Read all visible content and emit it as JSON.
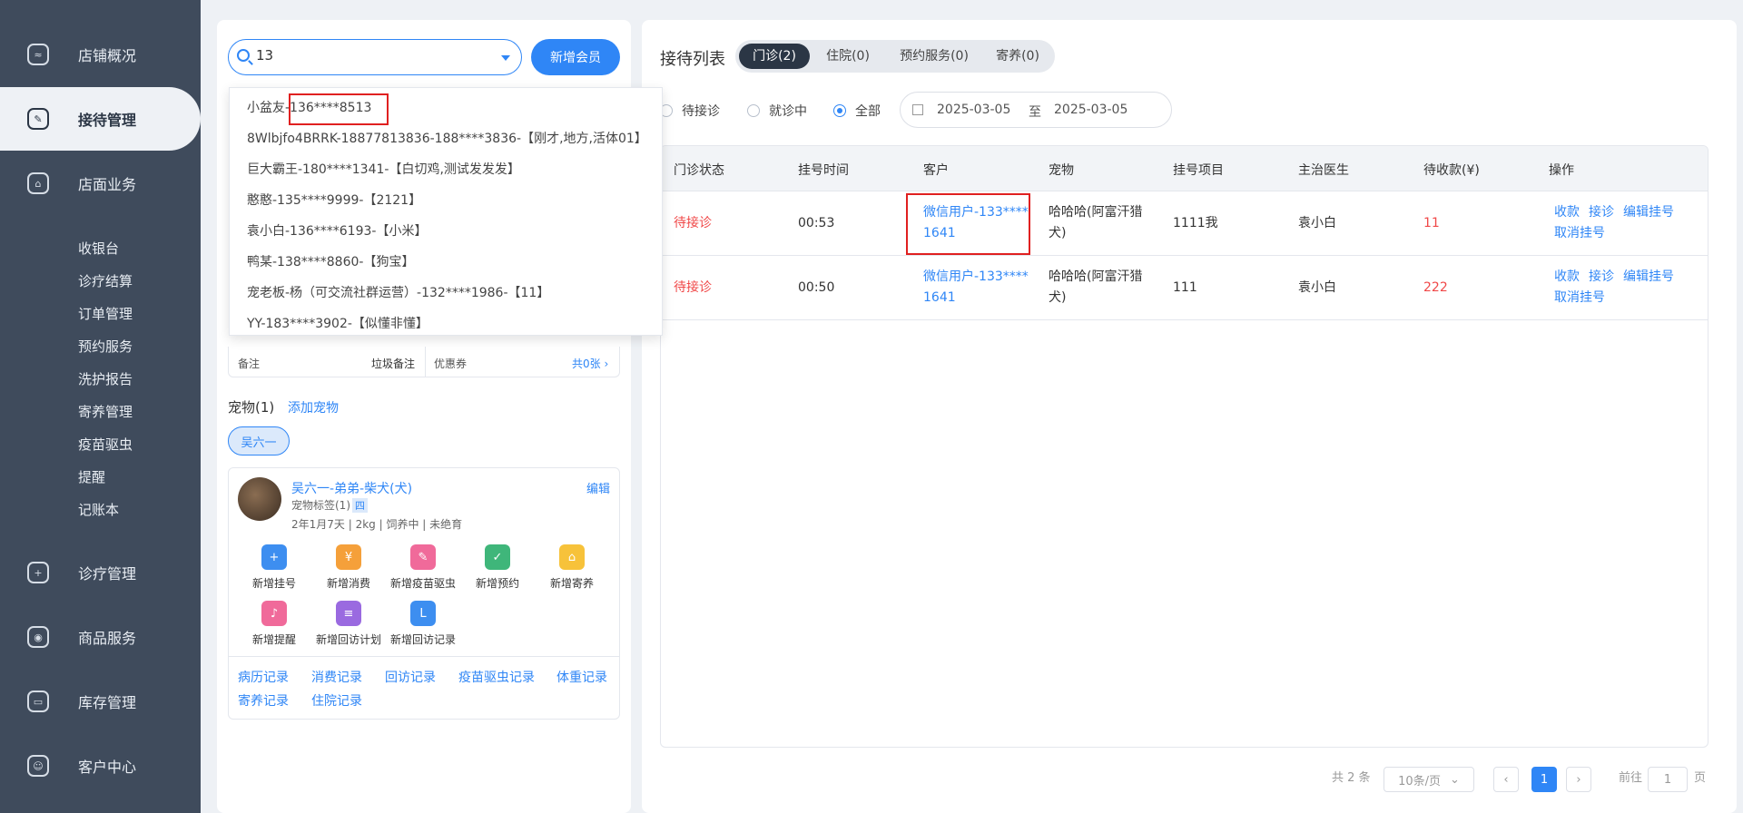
{
  "sidebar": {
    "items": [
      {
        "label": "店铺概况",
        "icon": "dashboard-icon"
      },
      {
        "label": "接待管理",
        "icon": "reception-icon",
        "active": true
      },
      {
        "label": "店面业务",
        "icon": "store-icon"
      },
      {
        "label": "诊疗管理",
        "icon": "medical-icon"
      },
      {
        "label": "商品服务",
        "icon": "goods-icon"
      },
      {
        "label": "库存管理",
        "icon": "inventory-icon"
      },
      {
        "label": "客户中心",
        "icon": "customer-icon"
      }
    ],
    "sub_items": [
      "收银台",
      "诊疗结算",
      "订单管理",
      "预约服务",
      "洗护报告",
      "寄养管理",
      "疫苗驱虫",
      "提醒",
      "记账本"
    ]
  },
  "search": {
    "value": "13",
    "add_member": "新增会员"
  },
  "dropdown": {
    "items": [
      "小盆友-136****8513",
      "8Wlbjfo4BRRK-18877813836-188****3836-【刚才,地方,活体01】",
      "巨大霸王-180****1341-【白切鸡,测试发发发】",
      "憨憨-135****9999-【2121】",
      "袁小白-136****6193-【小米】",
      "鸭某-138****8860-【狗宝】",
      "宠老板-杨（可交流社群运营）-132****1986-【11】",
      "YY-183****3902-【似懂非懂】"
    ]
  },
  "info": {
    "note_label": "备注",
    "note_value": "垃圾备注",
    "coupon_label": "优惠券",
    "coupon_value": "共0张 ›"
  },
  "pets": {
    "title": "宠物(1)",
    "add": "添加宠物",
    "tag": "吴六一",
    "card": {
      "name": "吴六一-弟弟-柴犬(犬)",
      "edit": "编辑",
      "label": "宠物标签(1)",
      "label_chip": "四",
      "meta": "2年1月7天 | 2kg | 饲养中 |  未绝育",
      "actions": [
        {
          "label": "新增挂号",
          "icon": "medkit-icon",
          "color": "#3d8ef0",
          "glyph": "+"
        },
        {
          "label": "新增消费",
          "icon": "yuan-icon",
          "color": "#f5a03a",
          "glyph": "¥"
        },
        {
          "label": "新增疫苗驱虫",
          "icon": "syringe-icon",
          "color": "#f06a9a",
          "glyph": "✎"
        },
        {
          "label": "新增预约",
          "icon": "calendar-icon",
          "color": "#3fb67a",
          "glyph": "✓"
        },
        {
          "label": "新增寄养",
          "icon": "house-icon",
          "color": "#f7c23a",
          "glyph": "⌂"
        },
        {
          "label": "新增提醒",
          "icon": "bell-icon",
          "color": "#f06a9a",
          "glyph": "♪"
        },
        {
          "label": "新增回访计划",
          "icon": "chat-icon",
          "color": "#9a6ae0",
          "glyph": "≡"
        },
        {
          "label": "新增回访记录",
          "icon": "clipboard-icon",
          "color": "#3d8ef0",
          "glyph": "L"
        }
      ],
      "records": [
        "病历记录",
        "消费记录",
        "回访记录",
        "疫苗驱虫记录",
        "体重记录",
        "寄养记录",
        "住院记录"
      ]
    }
  },
  "reception": {
    "title": "接待列表",
    "tabs": [
      "门诊(2)",
      "住院(0)",
      "预约服务(0)",
      "寄养(0)"
    ],
    "filters": [
      "待接诊",
      "就诊中",
      "全部"
    ],
    "date_from": "2025-03-05",
    "date_sep": "至",
    "date_to": "2025-03-05",
    "columns": [
      "门诊状态",
      "挂号时间",
      "客户",
      "宠物",
      "挂号项目",
      "主治医生",
      "待收款(¥)",
      "操作"
    ],
    "rows": [
      {
        "status": "待接诊",
        "time": "00:53",
        "customer1": "微信用户-133****",
        "customer2": "1641",
        "pet1": "哈哈哈(阿富汗猎",
        "pet2": "犬)",
        "item": "1111我",
        "doctor": "袁小白",
        "amount": "11"
      },
      {
        "status": "待接诊",
        "time": "00:50",
        "customer1": "微信用户-133****",
        "customer2": "1641",
        "pet1": "哈哈哈(阿富汗猎",
        "pet2": "犬)",
        "item": "111",
        "doctor": "袁小白",
        "amount": "222"
      }
    ],
    "ops": [
      "收款",
      "接诊",
      "编辑挂号",
      "取消挂号"
    ]
  },
  "pager": {
    "total": "共 2 条",
    "size": "10条/页",
    "page": "1",
    "goto": "前往",
    "goto_value": "1",
    "unit": "页"
  }
}
